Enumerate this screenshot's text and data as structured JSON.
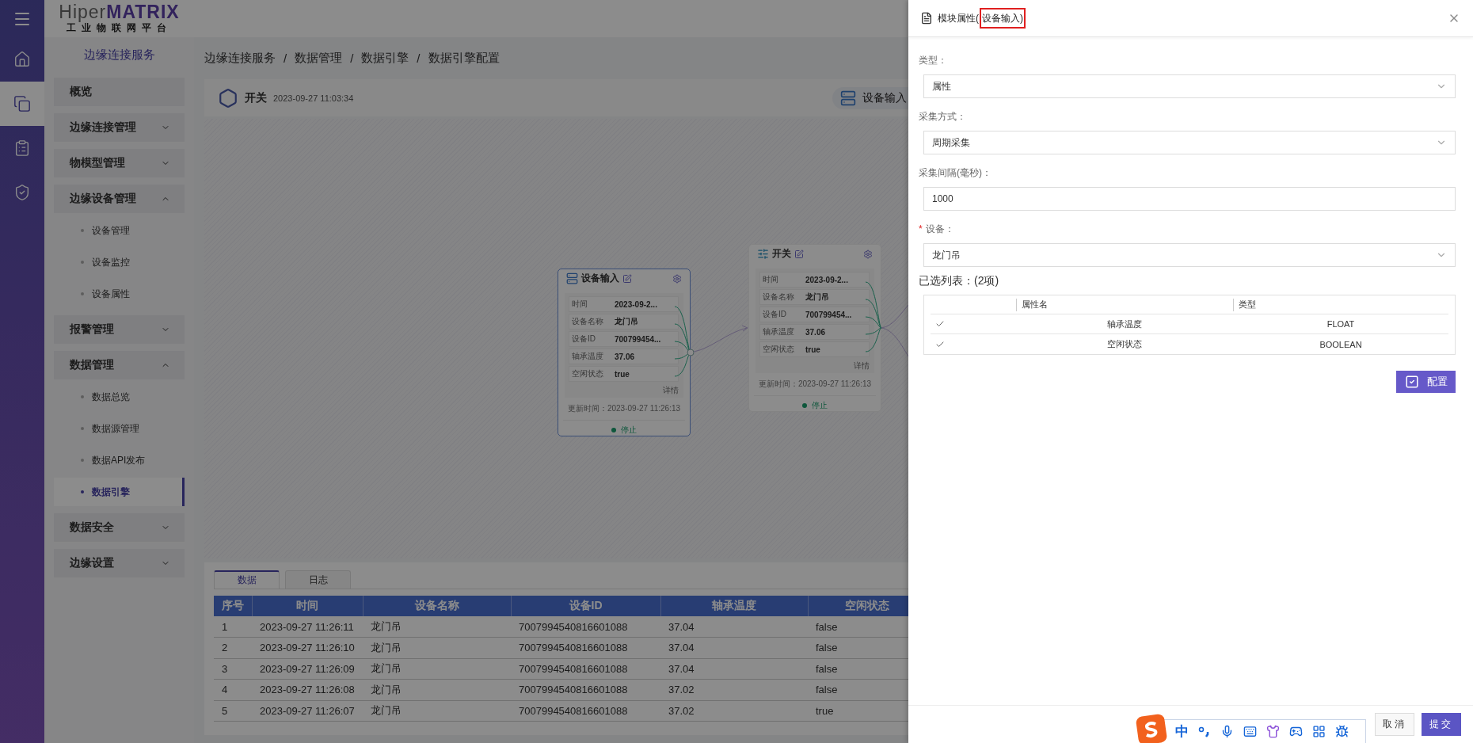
{
  "logo": {
    "brand_a": "Hiper",
    "brand_b": "MATRIX",
    "subtitle": "工业物联网平台"
  },
  "rail": [
    {
      "kind": "home",
      "selected": false
    },
    {
      "kind": "modules",
      "selected": true
    },
    {
      "kind": "document",
      "selected": false
    },
    {
      "kind": "shield",
      "selected": false
    }
  ],
  "sidebar": {
    "title": "边缘连接服务",
    "items": [
      {
        "label": "概览",
        "kind": "link"
      },
      {
        "label": "边缘连接管理",
        "kind": "group",
        "expanded": false
      },
      {
        "label": "物模型管理",
        "kind": "group",
        "expanded": false
      },
      {
        "label": "边缘设备管理",
        "kind": "group",
        "expanded": true,
        "children": [
          {
            "label": "设备管理",
            "selected": false
          },
          {
            "label": "设备监控",
            "selected": false
          },
          {
            "label": "设备属性",
            "selected": false
          }
        ]
      },
      {
        "label": "报警管理",
        "kind": "group",
        "expanded": false
      },
      {
        "label": "数据管理",
        "kind": "group",
        "expanded": true,
        "children": [
          {
            "label": "数据总览",
            "selected": false
          },
          {
            "label": "数据源管理",
            "selected": false
          },
          {
            "label": "数据API发布",
            "selected": false
          },
          {
            "label": "数据引擎",
            "selected": true
          }
        ]
      },
      {
        "label": "数据安全",
        "kind": "group",
        "expanded": false
      },
      {
        "label": "边缘设置",
        "kind": "group",
        "expanded": false
      }
    ]
  },
  "breadcrumb": {
    "separator": "/",
    "items": [
      "边缘连接服务",
      "数据管理",
      "数据引擎",
      "数据引擎配置"
    ]
  },
  "header": {
    "title": "开关",
    "time": "2023-09-27 11:03:34",
    "action": "设备输入"
  },
  "nodes": [
    {
      "kind": "device",
      "title": "设备输入",
      "selected": true,
      "fields": [
        {
          "label": "时间",
          "value": "2023-09-2..."
        },
        {
          "label": "设备名称",
          "value": "龙门吊"
        },
        {
          "label": "设备ID",
          "value": "700799454..."
        },
        {
          "label": "轴承温度",
          "value": "37.06"
        },
        {
          "label": "空闲状态",
          "value": "true"
        }
      ],
      "detail": "详情",
      "updated_label": "更新时间：",
      "updated": "2023-09-27 11:26:13",
      "status": "停止"
    },
    {
      "kind": "switch",
      "title": "开关",
      "selected": false,
      "fields": [
        {
          "label": "时间",
          "value": "2023-09-2..."
        },
        {
          "label": "设备名称",
          "value": "龙门吊"
        },
        {
          "label": "设备ID",
          "value": "700799454..."
        },
        {
          "label": "轴承温度",
          "value": "37.06"
        },
        {
          "label": "空闲状态",
          "value": "true"
        }
      ],
      "detail": "详情",
      "updated_label": "更新时间：",
      "updated": "2023-09-27 11:26:13",
      "status": "停止"
    }
  ],
  "bottom_tabs": [
    {
      "label": "数据",
      "selected": true
    },
    {
      "label": "日志",
      "selected": false
    }
  ],
  "table": {
    "columns": [
      "序号",
      "时间",
      "设备名称",
      "设备ID",
      "轴承温度",
      "空闲状态"
    ],
    "rows": [
      [
        "1",
        "2023-09-27 11:26:11",
        "龙门吊",
        "7007994540816601088",
        "37.04",
        "false"
      ],
      [
        "2",
        "2023-09-27 11:26:10",
        "龙门吊",
        "7007994540816601088",
        "37.04",
        "false"
      ],
      [
        "3",
        "2023-09-27 11:26:09",
        "龙门吊",
        "7007994540816601088",
        "37.04",
        "false"
      ],
      [
        "4",
        "2023-09-27 11:26:08",
        "龙门吊",
        "7007994540816601088",
        "37.02",
        "false"
      ],
      [
        "5",
        "2023-09-27 11:26:07",
        "龙门吊",
        "7007994540816601088",
        "37.02",
        "true"
      ]
    ]
  },
  "drawer": {
    "title": "模块属性(",
    "title_highlight": "设备输入)",
    "fields": [
      {
        "kind": "select",
        "label": "类型：",
        "value": "属性"
      },
      {
        "kind": "select",
        "label": "采集方式：",
        "value": "周期采集"
      },
      {
        "kind": "input",
        "label": "采集间隔(毫秒)：",
        "value": "1000"
      },
      {
        "kind": "select",
        "label": "设备：",
        "required_mark": "*",
        "value": "龙门吊"
      }
    ],
    "selected_title": "已选列表：(2项)",
    "selected_columns": [
      "属性名",
      "类型"
    ],
    "selected_rows": [
      {
        "name": "轴承温度",
        "type": "FLOAT",
        "checked": true
      },
      {
        "name": "空闲状态",
        "type": "BOOLEAN",
        "checked": true
      }
    ],
    "config_button": "配置",
    "buttons": [
      {
        "label": "取消",
        "kind": "secondary"
      },
      {
        "label": "提交",
        "kind": "primary"
      }
    ]
  },
  "ime_toolbar": {
    "label": "中"
  }
}
